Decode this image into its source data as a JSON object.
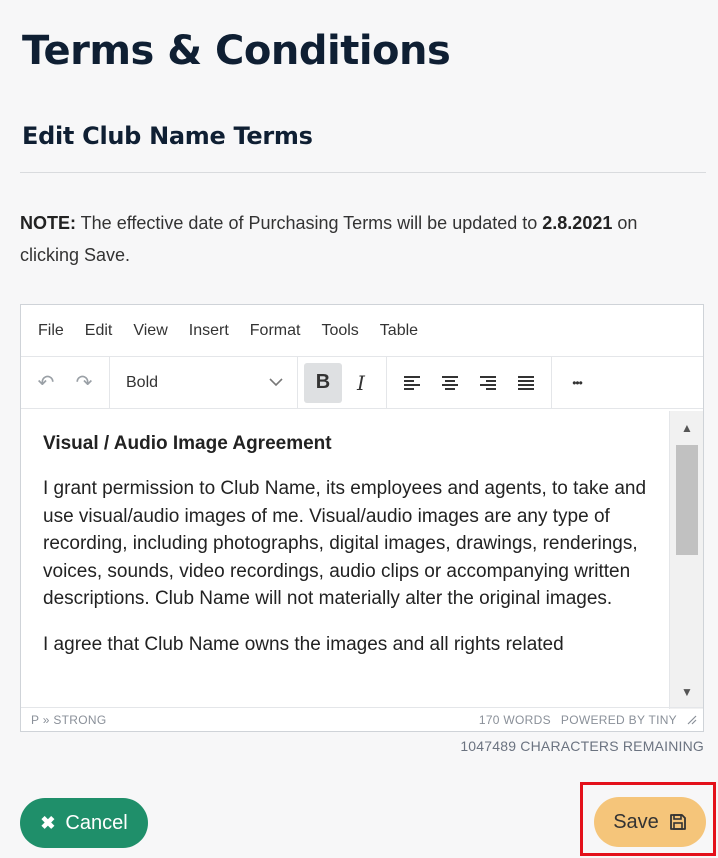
{
  "page": {
    "title": "Terms & Conditions",
    "section_title": "Edit Club Name Terms"
  },
  "note": {
    "label": "NOTE:",
    "text_before": " The effective date of Purchasing Terms will be updated to ",
    "date": "2.8.2021",
    "text_after": " on clicking Save."
  },
  "editor": {
    "menu": [
      "File",
      "Edit",
      "View",
      "Insert",
      "Format",
      "Tools",
      "Table"
    ],
    "toolbar": {
      "undo_icon": "↶",
      "redo_icon": "↷",
      "format_value": "Bold",
      "bold_label": "B",
      "italic_label": "I",
      "more_label": "•••"
    },
    "content": {
      "heading": "Visual / Audio Image Agreement",
      "paragraph_1": "I grant permission to Club Name, its employees and agents, to take and use visual/audio images of me. Visual/audio images are any type of recording, including photographs, digital images, drawings, renderings, voices, sounds, video recordings, audio clips or accompanying written descriptions. Club Name will not materially alter the original images.",
      "paragraph_2": "I agree that Club Name owns the images and all rights related"
    },
    "statusbar": {
      "path": "P » STRONG",
      "word_count": "170 WORDS",
      "powered_by": "POWERED BY TINY"
    },
    "characters_remaining": "1047489 CHARACTERS REMAINING"
  },
  "actions": {
    "cancel_label": "Cancel",
    "save_label": "Save"
  },
  "colors": {
    "cancel_bg": "#1f8f6a",
    "save_bg": "#f5c57a",
    "highlight_border": "#e3101a",
    "title": "#0f1f33"
  }
}
